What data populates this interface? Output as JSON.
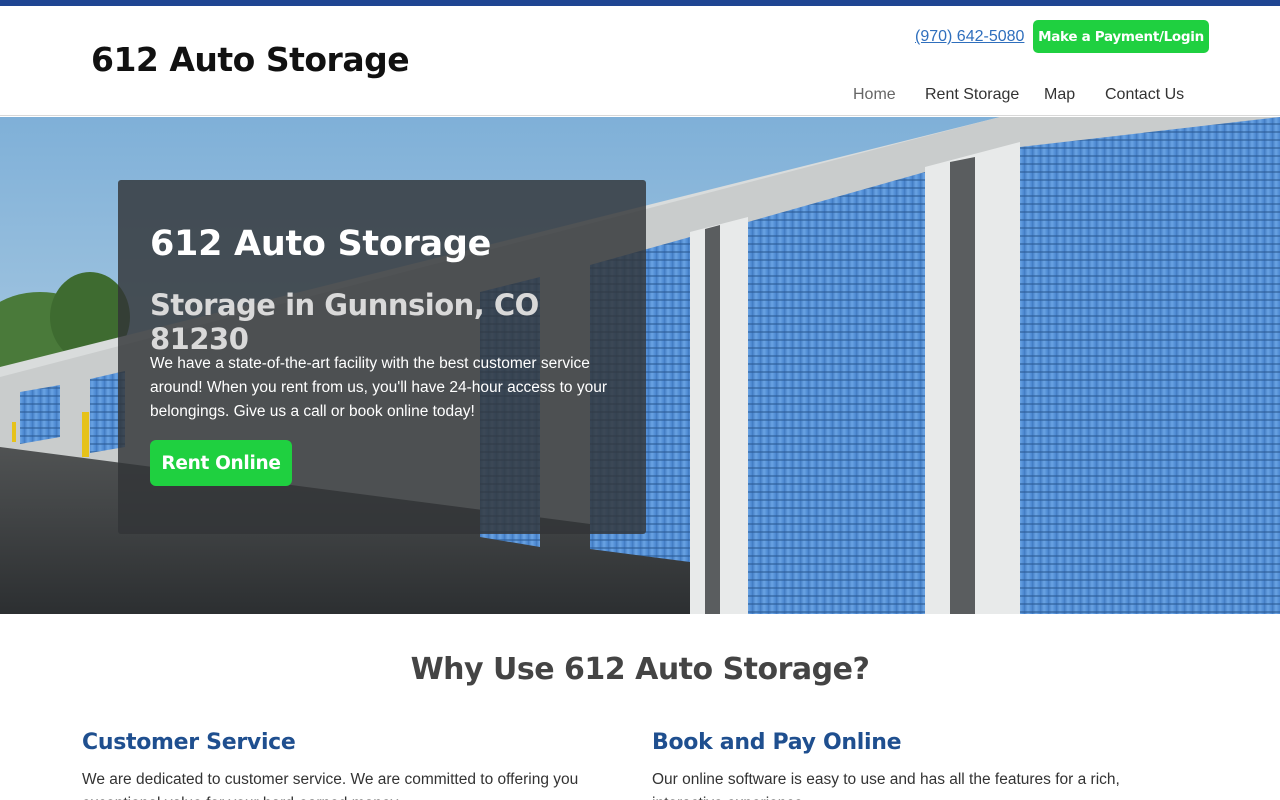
{
  "header": {
    "brand": "612 Auto Storage",
    "phone": "(970) 642-5080",
    "payment_label": "Make a Payment/Login"
  },
  "nav": {
    "items": [
      {
        "label": "Home",
        "active": true
      },
      {
        "label": "Rent Storage"
      },
      {
        "label": "Map"
      },
      {
        "label": "Contact Us"
      }
    ]
  },
  "hero": {
    "title": "612 Auto Storage",
    "subtitle": "Storage in Gunnsion, CO 81230",
    "text": "We have a state-of-the-art facility with the best customer service around! When you rent from us, you'll have 24-hour access to your belongings. Give us a call or book online today!",
    "cta_label": "Rent Online"
  },
  "why": {
    "title": "Why Use 612 Auto Storage?",
    "features": [
      {
        "title": "Customer Service",
        "text": "We are dedicated to customer service. We are committed to offering you exceptional value for your hard-earned money."
      },
      {
        "title": "Book and Pay Online",
        "text": "Our online software is easy to use and has all the features for a rich, interactive experience."
      }
    ]
  },
  "colors": {
    "accent_green": "#1fd040",
    "brand_blue": "#1f4592",
    "heading_blue": "#1f4f8f",
    "link_blue": "#2f6fbd"
  }
}
